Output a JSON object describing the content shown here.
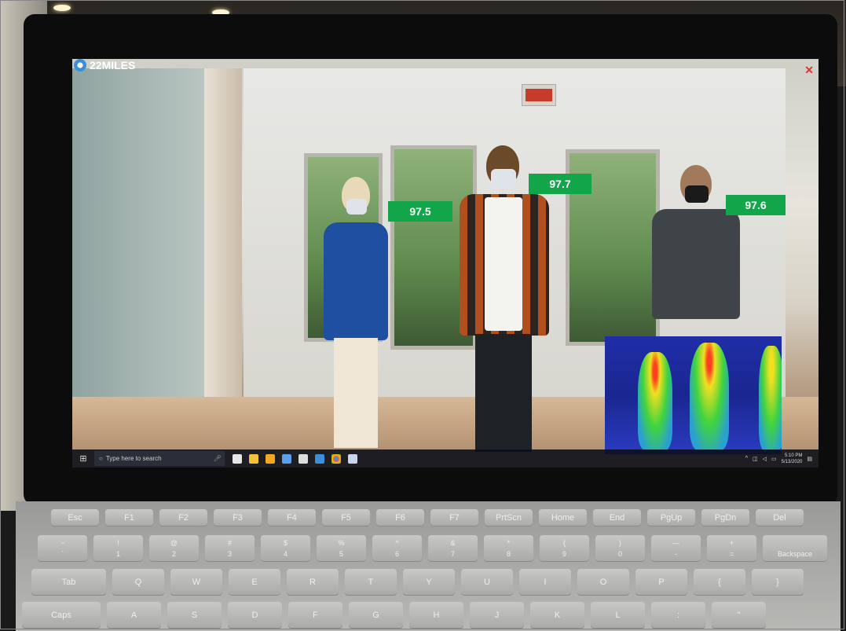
{
  "app": {
    "logo_text": "22MILES",
    "close_label": "✕"
  },
  "temperatures": [
    "97.5",
    "97.7",
    "97.6"
  ],
  "exit_sign": "EXIT",
  "taskbar": {
    "start_icon": "windows-icon",
    "search_placeholder": "Type here to search",
    "time": "5:10 PM",
    "date": "5/13/2020"
  },
  "keyboard": {
    "fn_row": [
      "Esc",
      "F1",
      "F2",
      "F3",
      "F4",
      "F5",
      "F6",
      "F7",
      "PrtScn",
      "Home",
      "End",
      "PgUp",
      "PgDn",
      "Del"
    ],
    "num_row": [
      {
        "top": "~",
        "bottom": "`"
      },
      {
        "top": "!",
        "bottom": "1"
      },
      {
        "top": "@",
        "bottom": "2"
      },
      {
        "top": "#",
        "bottom": "3"
      },
      {
        "top": "$",
        "bottom": "4"
      },
      {
        "top": "%",
        "bottom": "5"
      },
      {
        "top": "^",
        "bottom": "6"
      },
      {
        "top": "&",
        "bottom": "7"
      },
      {
        "top": "*",
        "bottom": "8"
      },
      {
        "top": "(",
        "bottom": "9"
      },
      {
        "top": ")",
        "bottom": "0"
      },
      {
        "top": "—",
        "bottom": "-"
      },
      {
        "top": "+",
        "bottom": "="
      },
      {
        "top": "",
        "bottom": "Backspace"
      }
    ],
    "q_row": [
      "Tab",
      "Q",
      "W",
      "E",
      "R",
      "T",
      "Y",
      "U",
      "I",
      "O",
      "P",
      "{",
      "}"
    ],
    "a_row": [
      "Caps",
      "A",
      "S",
      "D",
      "F",
      "G",
      "H",
      "J",
      "K",
      "L",
      ":",
      "\""
    ]
  }
}
